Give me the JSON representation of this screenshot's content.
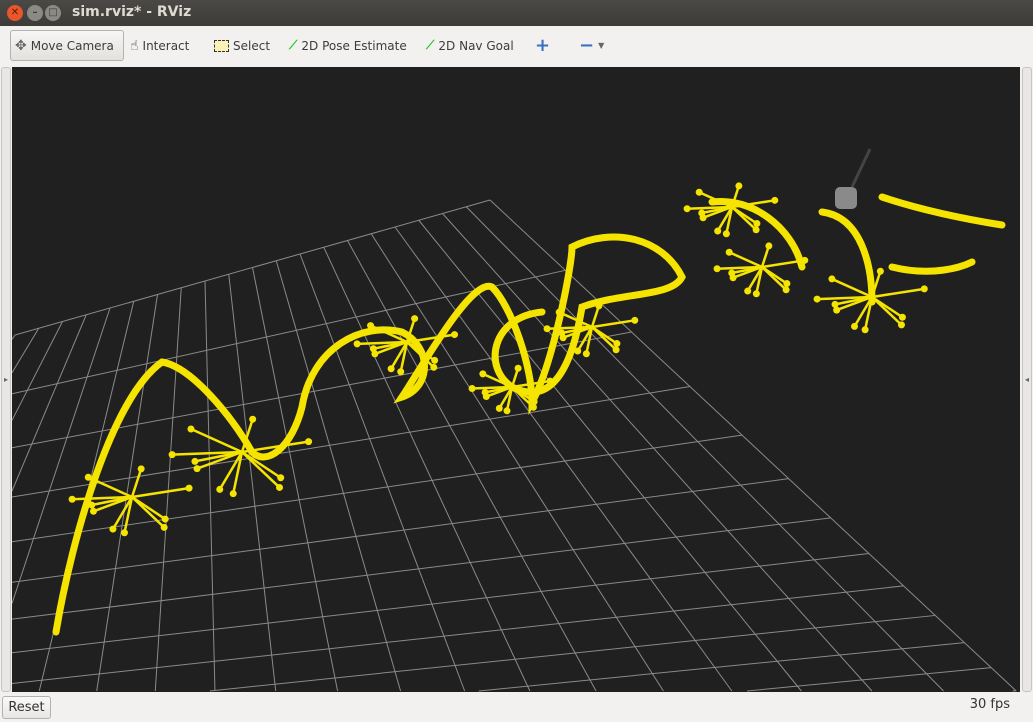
{
  "window": {
    "title": "sim.rviz* - RViz"
  },
  "toolbar": {
    "move_camera": "Move Camera",
    "interact": "Interact",
    "select": "Select",
    "pose_estimate": "2D Pose Estimate",
    "nav_goal": "2D Nav Goal"
  },
  "status": {
    "reset": "Reset",
    "fps": "30 fps"
  },
  "colors": {
    "arrows": "#f5e400",
    "grid": "#8a8a8a",
    "background": "#202020"
  }
}
